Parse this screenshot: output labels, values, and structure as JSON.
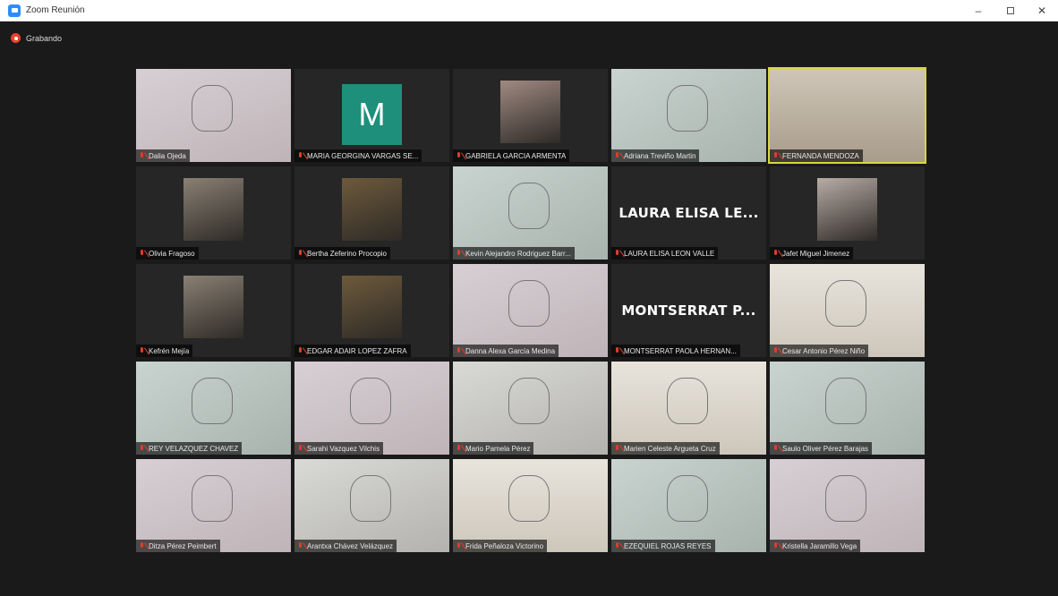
{
  "window": {
    "title": "Zoom Reunión",
    "min": "–",
    "close": "✕"
  },
  "recording": {
    "label": "Grabando"
  },
  "participants": [
    {
      "name": "Dalia Ojeda",
      "view": "paper"
    },
    {
      "name": "MARIA GEORGINA VARGAS SE...",
      "view": "avatar",
      "initial": "M"
    },
    {
      "name": "GABRIELA GARCIA ARMENTA",
      "view": "photo"
    },
    {
      "name": "Adriana Treviño Martin",
      "view": "paper"
    },
    {
      "name": "FERNANDA MENDOZA",
      "view": "room",
      "active": true
    },
    {
      "name": "Olivia Fragoso",
      "view": "photo"
    },
    {
      "name": "Bertha Zeferino Procopio",
      "view": "photo"
    },
    {
      "name": "Kevin Alejandro Rodriguez Barr...",
      "view": "paper"
    },
    {
      "name": "LAURA ELISA LEON VALLE",
      "view": "name",
      "display": "LAURA ELISA LE..."
    },
    {
      "name": "Jafet Miguel Jimenez",
      "view": "photo"
    },
    {
      "name": "Kefrén Mejía",
      "view": "photo"
    },
    {
      "name": "EDGAR ADAIR LOPEZ ZAFRA",
      "view": "photo"
    },
    {
      "name": "Danna Alexa García Medina",
      "view": "paper"
    },
    {
      "name": "MONTSERRAT PAOLA HERNAN...",
      "view": "name",
      "display": "MONTSERRAT P..."
    },
    {
      "name": "Cesar Antonio Pérez Niño",
      "view": "paper"
    },
    {
      "name": "REY VELAZQUEZ CHAVEZ",
      "view": "paper"
    },
    {
      "name": "Sarahi Vazquez Vilchis",
      "view": "paper"
    },
    {
      "name": "Mario Pamela Pérez",
      "view": "paper"
    },
    {
      "name": "Marien Celeste Argueta Cruz",
      "view": "paper"
    },
    {
      "name": "Saulo Oliver Pérez Barajas",
      "view": "paper"
    },
    {
      "name": "Ditza Pérez Peimbert",
      "view": "paper"
    },
    {
      "name": "Arantxa Chávez Velázquez",
      "view": "paper"
    },
    {
      "name": "Frida Peñaloza Victorino",
      "view": "paper"
    },
    {
      "name": "EZEQUIEL ROJAS REYES",
      "view": "paper"
    },
    {
      "name": "Kristella Jaramillo Vega",
      "view": "paper"
    }
  ],
  "colors": {
    "tile_bg": "#262626",
    "active_border": "#d8d640",
    "mic_muted": "#e03c2c",
    "avatar": "#1e8f7a"
  }
}
